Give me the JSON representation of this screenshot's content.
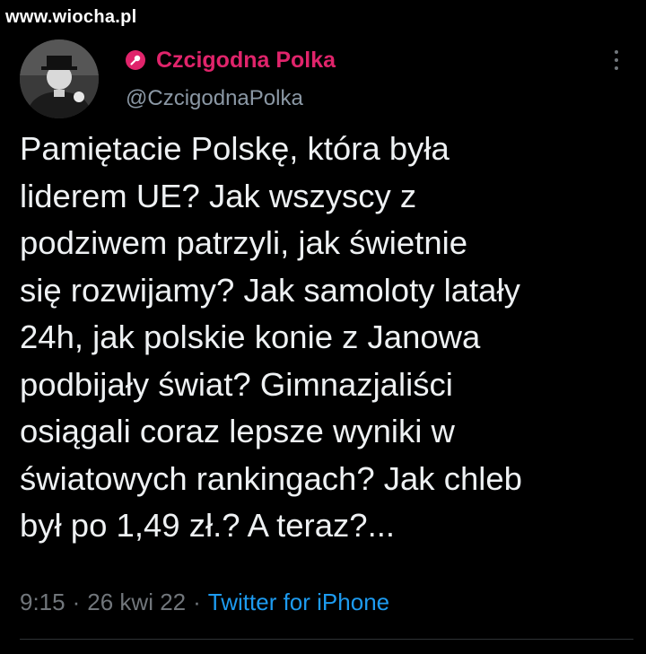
{
  "watermark": "www.wiocha.pl",
  "author": {
    "display_name": "Czcigodna Polka",
    "handle": "@CzcigodnaPolka",
    "badge_icon": "microphone-icon",
    "name_color": "#e0246b"
  },
  "tweet": {
    "text": "Pamiętacie Polskę, która była\nliderem UE? Jak wszyscy z\npodziwem patrzyli, jak świetnie\nsię rozwijamy? Jak samoloty latały\n24h, jak polskie konie z Janowa\npodbijały świat? Gimnazjaliści\nosiągali coraz lepsze wyniki w\nświatowych rankingach? Jak chleb\nbył po 1,49 zł.? A teraz?..."
  },
  "meta": {
    "time": "9:15",
    "separator": "·",
    "date": "26 kwi 22",
    "source": "Twitter for iPhone",
    "source_color": "#1d9bf0"
  },
  "menu": {
    "icon": "more-vertical-icon"
  }
}
